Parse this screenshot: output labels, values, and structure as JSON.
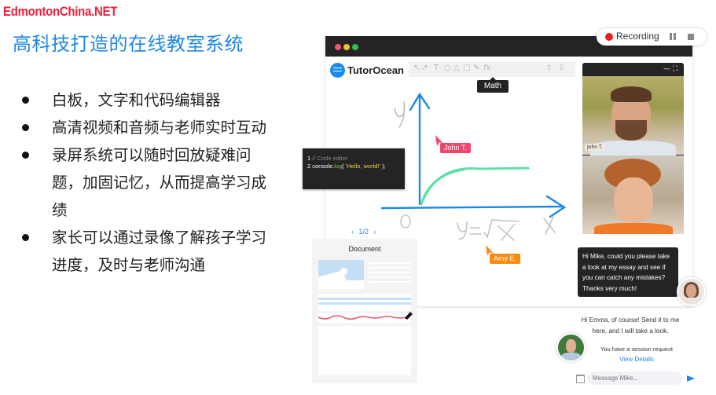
{
  "watermark": "EdmontonChina.NET",
  "headline": "高科技打造的在线教室系统",
  "bullets": [
    {
      "text": "白板，文字和代码编辑器"
    },
    {
      "text": "高清视频和音频与老师实时互动"
    },
    {
      "text": "录屏系统可以随时回放疑难问题，加固记忆，从而提高学习成绩"
    },
    {
      "text": "家长可以通过录像了解孩子学习进度，及时与老师沟通"
    }
  ],
  "recording": {
    "label": "Recording",
    "pause_icon": "pause-icon",
    "stop_icon": "stop-icon",
    "color": "#ee1c1c"
  },
  "app": {
    "brand": "TutorOcean",
    "brand_color": "#1a8cf0",
    "toolbar": {
      "tools": [
        "↖",
        "↗",
        "T",
        "○",
        "△",
        "□",
        "✎",
        "fx"
      ],
      "right_tools": [
        "⇧",
        "⇩"
      ],
      "tooltip": "Math"
    },
    "whiteboard": {
      "y_label": "y",
      "x_label": "X",
      "origin_label": "O",
      "formula": "y=√x",
      "axis_color": "#1e88e5",
      "curve_color": "#5fe0a8"
    },
    "code_editor": {
      "line1_num": "1",
      "line1": "// Code editor",
      "line2_num": "2",
      "line2_obj": "console.",
      "line2_fn": "log",
      "line2_open": "( ",
      "line2_str": "'Hello, world!'",
      "line2_close": " );"
    },
    "cursors": [
      {
        "name": "John T.",
        "color": "#f0456b"
      },
      {
        "name": "Amy E.",
        "color": "#f98a12"
      }
    ],
    "video": {
      "minimize": "—",
      "fullscreen": "⛶",
      "tile1_name": "John T."
    },
    "document": {
      "pager_prev": "‹",
      "pager": "1/2",
      "pager_next": "›",
      "title": "Document"
    },
    "chat": {
      "incoming": "Hi Mike, could you please take a look at my essay and see if you can catch any mistakes? Thanks very much!",
      "outgoing": "Hi Emma, of course! Send it to me here, and I will take a look.",
      "session_notice": "You have a session request",
      "view_details": "View Details",
      "input_placeholder": "Message Mike..."
    }
  }
}
